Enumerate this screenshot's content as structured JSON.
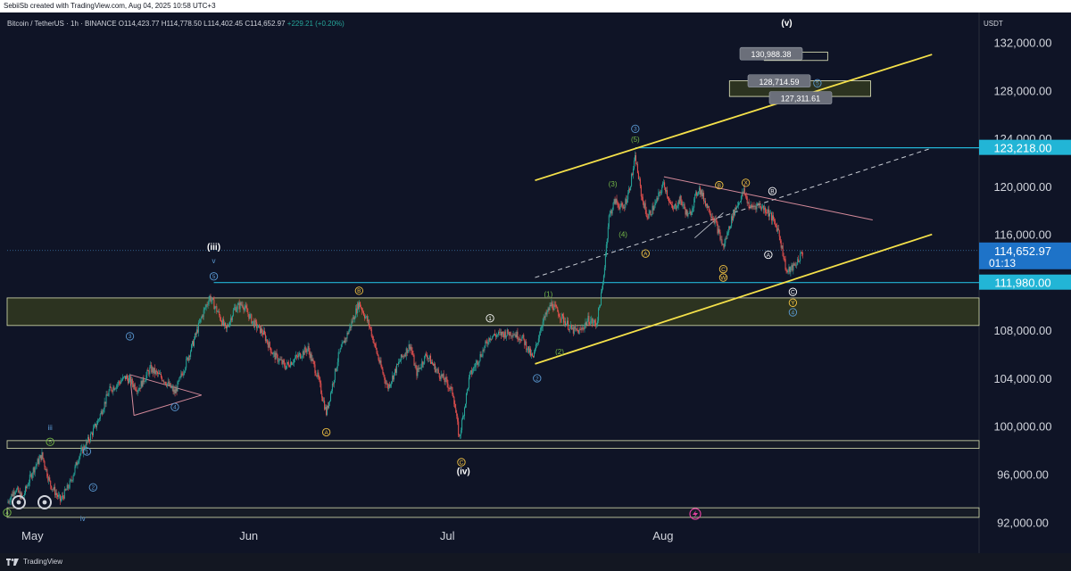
{
  "header": {
    "created_by": "SebiiSb created with TradingView.com, Aug 04, 2025 10:58 UTC+3"
  },
  "symbol_bar": {
    "title": "Bitcoin / TetherUS · 1h · BINANCE",
    "open": "O114,423.77",
    "high": "H114,778.50",
    "low": "L114,402.45",
    "close": "C114,652.97",
    "change": "+229.21 (+0.20%)"
  },
  "currency": "USDT",
  "footer": {
    "brand": "TradingView"
  },
  "colors": {
    "background": "#0f1426",
    "up_candle": "#26a69a",
    "down_candle": "#ef5350",
    "channel": "#f5e14a",
    "level_line": "#22b5d6",
    "zone_fill": "#2c3320",
    "label_box": "#6b6f7a"
  },
  "chart_data": {
    "type": "candlestick",
    "symbol": "Bitcoin / TetherUS",
    "interval": "1h",
    "x": [
      "May",
      "Jun",
      "Jul",
      "Aug"
    ],
    "ylim": [
      91500,
      134500
    ],
    "y_ticks": [
      "132,000.00",
      "128,000.00",
      "124,000.00",
      "120,000.00",
      "116,000.00",
      "108,000.00",
      "104,000.00",
      "100,000.00",
      "96,000.00",
      "92,000.00"
    ],
    "price_tags": [
      {
        "label": "123,218.00",
        "value": 123218,
        "color": "#22b5d6",
        "extra": ""
      },
      {
        "label": "114,652.97",
        "value": 114653,
        "color": "#1e73c8",
        "extra": "01:13"
      },
      {
        "label": "111,980.00",
        "value": 111980,
        "color": "#22b5d6",
        "extra": ""
      }
    ],
    "target_labels": [
      {
        "text": "130,988.38",
        "value": 130988
      },
      {
        "text": "128,714.59",
        "value": 128715
      },
      {
        "text": "127,311.61",
        "value": 127312
      }
    ],
    "path": [
      [
        0.0,
        93600
      ],
      [
        0.8,
        94800
      ],
      [
        1.5,
        94000
      ],
      [
        2.5,
        96300
      ],
      [
        3.4,
        97600
      ],
      [
        4.2,
        95200
      ],
      [
        5.2,
        93800
      ],
      [
        6.2,
        95300
      ],
      [
        7.0,
        97500
      ],
      [
        7.8,
        98600
      ],
      [
        8.8,
        100300
      ],
      [
        10.0,
        103000
      ],
      [
        11.6,
        104100
      ],
      [
        12.8,
        103100
      ],
      [
        14.0,
        104800
      ],
      [
        15.2,
        104000
      ],
      [
        16.4,
        102800
      ],
      [
        17.2,
        104600
      ],
      [
        18.0,
        106500
      ],
      [
        19.0,
        109100
      ],
      [
        19.8,
        110800
      ],
      [
        20.6,
        109500
      ],
      [
        21.4,
        108000
      ],
      [
        22.2,
        109800
      ],
      [
        23.0,
        110200
      ],
      [
        24.0,
        108700
      ],
      [
        25.0,
        107800
      ],
      [
        26.0,
        106000
      ],
      [
        27.2,
        105000
      ],
      [
        28.4,
        105800
      ],
      [
        29.4,
        106500
      ],
      [
        30.4,
        104000
      ],
      [
        31.2,
        101100
      ],
      [
        32.4,
        105900
      ],
      [
        33.4,
        108000
      ],
      [
        34.4,
        110300
      ],
      [
        35.4,
        108400
      ],
      [
        36.4,
        105300
      ],
      [
        37.2,
        103200
      ],
      [
        38.4,
        105500
      ],
      [
        39.4,
        106800
      ],
      [
        40.0,
        104400
      ],
      [
        41.0,
        106000
      ],
      [
        42.0,
        104600
      ],
      [
        43.0,
        103600
      ],
      [
        43.6,
        102700
      ],
      [
        44.2,
        99000
      ],
      [
        45.2,
        104200
      ],
      [
        46.2,
        105800
      ],
      [
        47.2,
        107500
      ],
      [
        48.4,
        107700
      ],
      [
        49.4,
        107800
      ],
      [
        50.4,
        107300
      ],
      [
        51.4,
        105600
      ],
      [
        52.2,
        108400
      ],
      [
        53.2,
        110200
      ],
      [
        54.2,
        109100
      ],
      [
        55.2,
        108000
      ],
      [
        56.0,
        107900
      ],
      [
        56.8,
        108900
      ],
      [
        57.6,
        108500
      ],
      [
        58.2,
        111600
      ],
      [
        58.8,
        117400
      ],
      [
        59.4,
        118800
      ],
      [
        60.2,
        118100
      ],
      [
        60.8,
        119700
      ],
      [
        61.4,
        122400
      ],
      [
        62.0,
        119200
      ],
      [
        62.6,
        117400
      ],
      [
        63.4,
        118600
      ],
      [
        64.2,
        120300
      ],
      [
        65.0,
        118000
      ],
      [
        65.8,
        118900
      ],
      [
        66.6,
        117400
      ],
      [
        67.6,
        119900
      ],
      [
        68.4,
        118400
      ],
      [
        69.2,
        117100
      ],
      [
        70.0,
        114900
      ],
      [
        71.0,
        117800
      ],
      [
        72.0,
        119600
      ],
      [
        72.6,
        118200
      ],
      [
        73.4,
        118500
      ],
      [
        74.4,
        117900
      ],
      [
        75.4,
        116300
      ],
      [
        76.2,
        112800
      ],
      [
        77.0,
        113400
      ],
      [
        77.8,
        114600
      ]
    ],
    "annotations": [
      {
        "text": "(v)",
        "x": 76.2,
        "y": 133400,
        "color": "#ffffff",
        "bold": true
      },
      {
        "text": "(iii)",
        "x": 20.2,
        "y": 114700,
        "color": "#ffffff",
        "bold": true
      },
      {
        "text": "(iv)",
        "x": 44.6,
        "y": 96000,
        "color": "#ffffff",
        "bold": true
      },
      {
        "text": "v",
        "x": 20.2,
        "y": 113600,
        "color": "#5b9bd5",
        "bold": false
      },
      {
        "text": "iii",
        "x": 4.2,
        "y": 99700,
        "color": "#5b9bd5",
        "bold": false
      },
      {
        "text": "iv",
        "x": 7.4,
        "y": 92100,
        "color": "#5b9bd5",
        "bold": false
      },
      {
        "text": "(1)",
        "x": 52.9,
        "y": 110800,
        "color": "#76b947",
        "bold": false
      },
      {
        "text": "(2)",
        "x": 54.0,
        "y": 106000,
        "color": "#76b947",
        "bold": false
      },
      {
        "text": "(3)",
        "x": 59.2,
        "y": 120000,
        "color": "#76b947",
        "bold": false
      },
      {
        "text": "(4)",
        "x": 60.2,
        "y": 115800,
        "color": "#76b947",
        "bold": false
      },
      {
        "text": "(5)",
        "x": 61.4,
        "y": 123700,
        "color": "#76b947",
        "bold": false
      }
    ],
    "circle_markers": [
      {
        "label": "3",
        "x": 61.4,
        "y": 124800,
        "color": "#5b9bd5"
      },
      {
        "label": "5",
        "x": 20.2,
        "y": 112500,
        "color": "#5b9bd5"
      },
      {
        "label": "3",
        "x": 12.0,
        "y": 107500,
        "color": "#5b9bd5"
      },
      {
        "label": "4",
        "x": 16.4,
        "y": 101600,
        "color": "#5b9bd5"
      },
      {
        "label": "5",
        "x": 4.2,
        "y": 98700,
        "color": "#76b947"
      },
      {
        "label": "1",
        "x": 7.8,
        "y": 97900,
        "color": "#5b9bd5"
      },
      {
        "label": "2",
        "x": 8.4,
        "y": 94900,
        "color": "#5b9bd5"
      },
      {
        "label": "1",
        "x": 47.2,
        "y": 109000,
        "color": "#ffffff"
      },
      {
        "label": "2",
        "x": 51.8,
        "y": 104000,
        "color": "#5b9bd5"
      },
      {
        "label": "A",
        "x": 62.4,
        "y": 114400,
        "color": "#f5c542"
      },
      {
        "label": "B",
        "x": 69.6,
        "y": 120100,
        "color": "#f5c542"
      },
      {
        "label": "X",
        "x": 72.2,
        "y": 120300,
        "color": "#f5c542"
      },
      {
        "label": "B",
        "x": 74.8,
        "y": 119600,
        "color": "#ffffff"
      },
      {
        "label": "A",
        "x": 74.4,
        "y": 114300,
        "color": "#ffffff"
      },
      {
        "label": "C",
        "x": 70.0,
        "y": 113100,
        "color": "#f5c542"
      },
      {
        "label": "W",
        "x": 70.0,
        "y": 112400,
        "color": "#f5c542"
      },
      {
        "label": "C",
        "x": 76.8,
        "y": 111200,
        "color": "#ffffff"
      },
      {
        "label": "Y",
        "x": 76.8,
        "y": 110300,
        "color": "#f5c542"
      },
      {
        "label": "4",
        "x": 76.8,
        "y": 109500,
        "color": "#5b9bd5"
      },
      {
        "label": "B",
        "x": 34.4,
        "y": 111300,
        "color": "#f5c542"
      },
      {
        "label": "A",
        "x": 31.2,
        "y": 99500,
        "color": "#f5c542"
      },
      {
        "label": "C",
        "x": 44.4,
        "y": 97000,
        "color": "#f5c542"
      },
      {
        "label": "5",
        "x": 79.2,
        "y": 128600,
        "color": "#5b9bd5"
      },
      {
        "label": "4",
        "x": 0.0,
        "y": 92800,
        "color": "#76b947"
      }
    ],
    "horizontal_lines": [
      {
        "value": 123218,
        "x_start": 61.4,
        "color": "#22b5d6",
        "width": 1.2,
        "dash": ""
      },
      {
        "value": 111980,
        "x_start": 20.2,
        "color": "#22b5d6",
        "width": 1.2,
        "dash": ""
      },
      {
        "value": 114653,
        "x_start": 0.0,
        "color": "#3a75a8",
        "width": 0.8,
        "dash": "1,2"
      }
    ],
    "zones": [
      {
        "low": 108400,
        "high": 110700,
        "fill": "#2c3320",
        "stroke": "#d9e0b0"
      },
      {
        "low": 98150,
        "high": 98800,
        "fill": "#161b26",
        "stroke": "#d9e0b0"
      },
      {
        "low": 92400,
        "high": 93200,
        "fill": "#161b26",
        "stroke": "#d9e0b0"
      }
    ],
    "target_boxes": [
      {
        "x1": 74.0,
        "x2": 80.2,
        "y_low": 130500,
        "y_high": 131200,
        "fill": "#0f1426"
      },
      {
        "x1": 70.6,
        "x2": 84.4,
        "y_low": 127500,
        "y_high": 128800,
        "fill": "#2c3320"
      }
    ],
    "trendlines": [
      {
        "x1": 51.6,
        "y1": 105200,
        "x2": 90.4,
        "y2": 116000,
        "color": "#f5e14a",
        "width": 1.8,
        "dash": ""
      },
      {
        "x1": 51.6,
        "y1": 120500,
        "x2": 90.4,
        "y2": 131000,
        "color": "#f5e14a",
        "width": 1.8,
        "dash": ""
      },
      {
        "x1": 51.6,
        "y1": 112400,
        "x2": 90.4,
        "y2": 123200,
        "color": "#c8ccd4",
        "width": 1,
        "dash": "5,4"
      },
      {
        "x1": 64.2,
        "y1": 120800,
        "x2": 84.6,
        "y2": 117200,
        "color": "#d48a9a",
        "width": 1,
        "dash": ""
      },
      {
        "x1": 12.0,
        "y1": 104300,
        "x2": 19.0,
        "y2": 102600,
        "color": "#d48a9a",
        "width": 1,
        "dash": ""
      },
      {
        "x1": 12.0,
        "y1": 104300,
        "x2": 12.4,
        "y2": 100900,
        "color": "#d48a9a",
        "width": 1,
        "dash": ""
      },
      {
        "x1": 12.4,
        "y1": 100900,
        "x2": 19.0,
        "y2": 102600,
        "color": "#d48a9a",
        "width": 1,
        "dash": ""
      },
      {
        "x1": 67.2,
        "y1": 115700,
        "x2": 70.0,
        "y2": 117800,
        "color": "#c8ccd4",
        "width": 0.8,
        "dash": ""
      }
    ]
  }
}
